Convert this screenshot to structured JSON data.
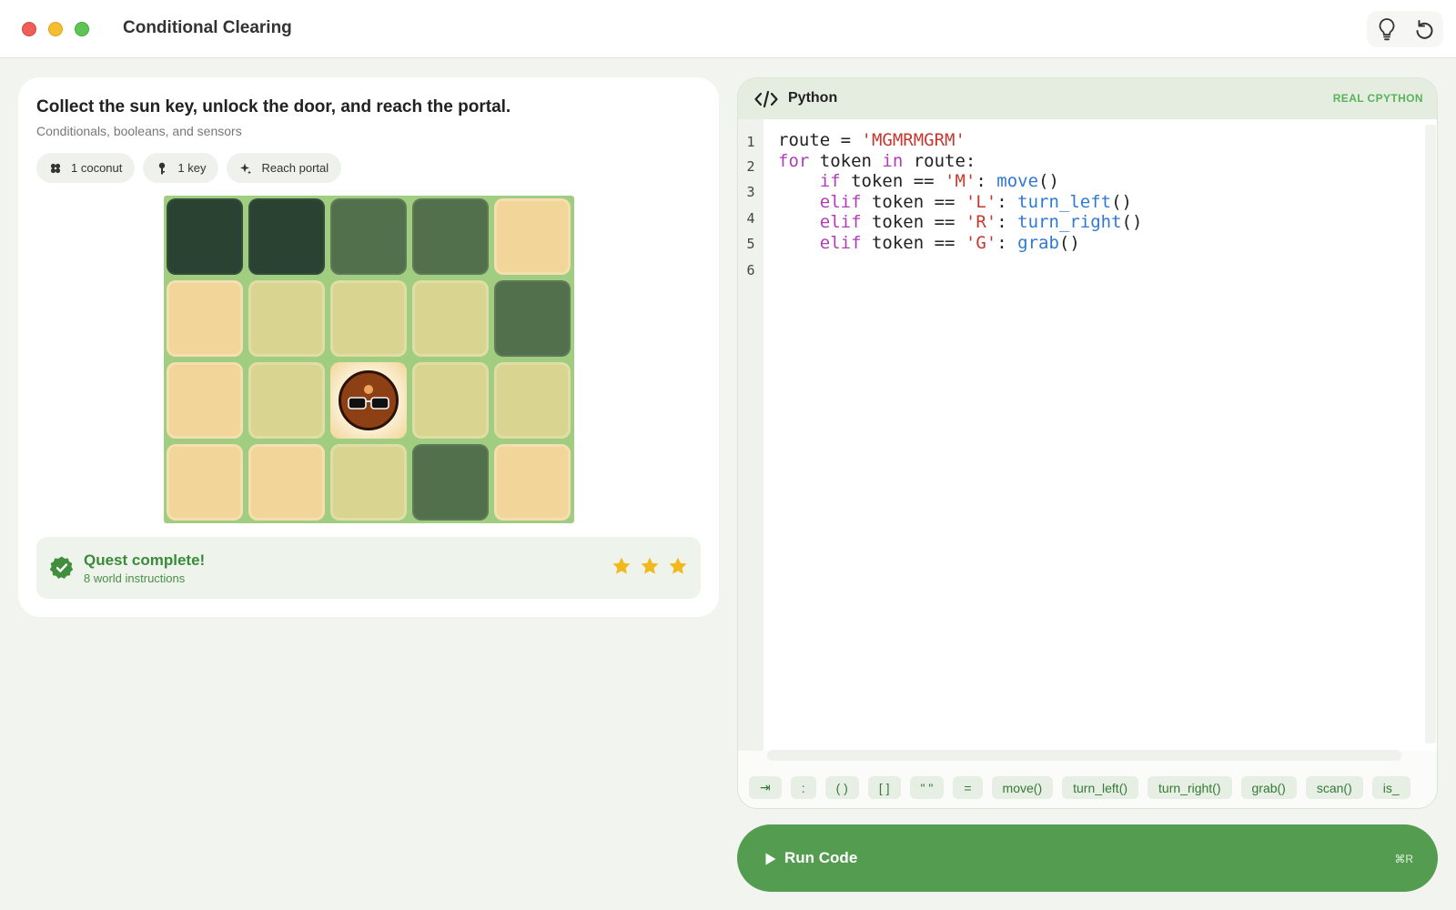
{
  "window": {
    "title": "Conditional Clearing"
  },
  "toolbar": {
    "hint_icon": "lightbulb-icon",
    "reset_icon": "undo-icon"
  },
  "task": {
    "title": "Collect the sun key, unlock the door, and reach the portal.",
    "subtitle": "Conditionals, booleans, and sensors",
    "chips": [
      {
        "icon": "coconut-icon",
        "label": "1 coconut"
      },
      {
        "icon": "key-icon",
        "label": "1 key"
      },
      {
        "icon": "sparkle-icon",
        "label": "Reach portal"
      }
    ]
  },
  "board": {
    "rows": [
      [
        "forest",
        "forest",
        "moss",
        "moss",
        "sand"
      ],
      [
        "sand",
        "grass",
        "grass",
        "grass",
        "moss"
      ],
      [
        "sand",
        "grass",
        "player",
        "grass",
        "grass"
      ],
      [
        "sand",
        "sand",
        "grass",
        "moss",
        "sand"
      ]
    ],
    "player": {
      "row": 2,
      "col": 2,
      "icon": "player-with-sunglasses-icon"
    }
  },
  "quest": {
    "title": "Quest complete!",
    "subtitle": "8 world instructions",
    "stars_earned": 3,
    "stars_total": 3,
    "star_color": "#f2b91b"
  },
  "editor": {
    "language": "Python",
    "badge": "REAL CPYTHON",
    "line_numbers": [
      "1",
      "2",
      "3",
      "4",
      "5",
      "6"
    ],
    "code": {
      "l1_var": "route = ",
      "l1_str": "'MGMRMGRM'",
      "l2_kw1": "for",
      "l2_mid": " token ",
      "l2_kw2": "in",
      "l2_end": " route:",
      "l3_indent": "    ",
      "l3_kw": "if",
      "l3_cmp": " token == ",
      "l3_str": "'M'",
      "l3_colon": ": ",
      "l3_fn": "move",
      "l3_paren": "()",
      "l4_indent": "    ",
      "l4_kw": "elif",
      "l4_cmp": " token == ",
      "l4_str": "'L'",
      "l4_colon": ": ",
      "l4_fn": "turn_left",
      "l4_paren": "()",
      "l5_indent": "    ",
      "l5_kw": "elif",
      "l5_cmp": " token == ",
      "l5_str": "'R'",
      "l5_colon": ": ",
      "l5_fn": "turn_right",
      "l5_paren": "()",
      "l6_indent": "    ",
      "l6_kw": "elif",
      "l6_cmp": " token == ",
      "l6_str": "'G'",
      "l6_colon": ": ",
      "l6_fn": "grab",
      "l6_paren": "()"
    },
    "snippets": [
      "⇥",
      ":",
      "( )",
      "[ ]",
      "\" \"",
      "=",
      "move()",
      "turn_left()",
      "turn_right()",
      "grab()",
      "scan()",
      "is_"
    ]
  },
  "run_button": {
    "label": "Run Code",
    "shortcut": "⌘R"
  },
  "colors": {
    "accent_green": "#539c50",
    "keyword": "#b03fb7",
    "string": "#c43a2f",
    "function": "#2f79d4"
  }
}
